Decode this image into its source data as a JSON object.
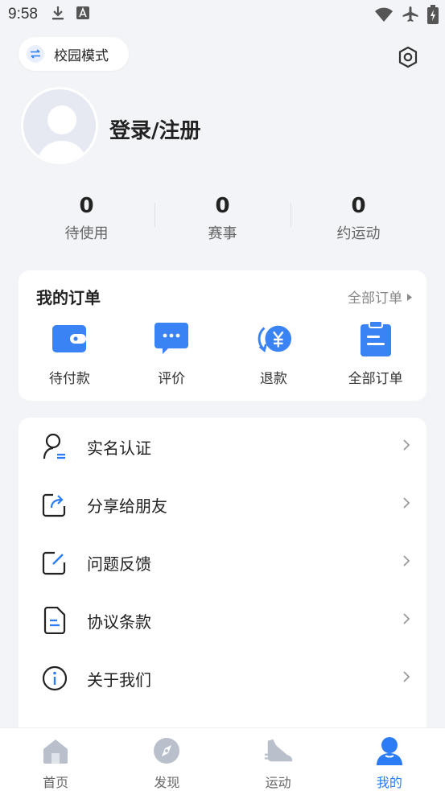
{
  "status_bar": {
    "time": "9:58"
  },
  "header": {
    "campus_mode_label": "校园模式"
  },
  "profile": {
    "login_label": "登录/注册"
  },
  "stats": [
    {
      "value": "0",
      "label": "待使用"
    },
    {
      "value": "0",
      "label": "赛事"
    },
    {
      "value": "0",
      "label": "约运动"
    }
  ],
  "orders": {
    "title": "我的订单",
    "all_link": "全部订单",
    "items": [
      {
        "label": "待付款",
        "icon": "wallet-icon"
      },
      {
        "label": "评价",
        "icon": "comment-icon"
      },
      {
        "label": "退款",
        "icon": "refund-icon"
      },
      {
        "label": "全部订单",
        "icon": "clipboard-icon"
      }
    ]
  },
  "menu": [
    {
      "label": "实名认证",
      "icon": "user-verify-icon"
    },
    {
      "label": "分享给朋友",
      "icon": "share-icon"
    },
    {
      "label": "问题反馈",
      "icon": "feedback-icon"
    },
    {
      "label": "协议条款",
      "icon": "document-icon"
    },
    {
      "label": "关于我们",
      "icon": "info-icon"
    }
  ],
  "tabbar": [
    {
      "label": "首页",
      "icon": "home-icon"
    },
    {
      "label": "发现",
      "icon": "compass-icon"
    },
    {
      "label": "运动",
      "icon": "sneaker-icon"
    },
    {
      "label": "我的",
      "icon": "profile-icon"
    }
  ],
  "colors": {
    "accent": "#2b7cf6",
    "background": "#f2f4f7"
  }
}
